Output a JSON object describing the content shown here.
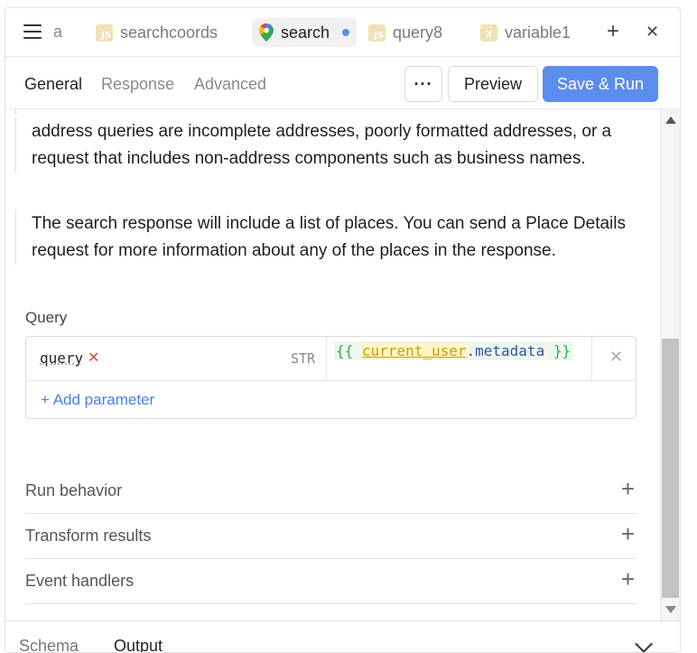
{
  "tabs": {
    "truncated_label": "a",
    "items": [
      {
        "label": "searchcoords",
        "icon": "js-icon",
        "badge": "JS"
      },
      {
        "label": "search",
        "icon": "google-maps-icon",
        "active": true,
        "unsaved": true
      },
      {
        "label": "query8",
        "icon": "js-icon",
        "badge": "JS"
      },
      {
        "label": "variable1",
        "icon": "variable-icon",
        "badge": "x"
      }
    ],
    "add_symbol": "+",
    "close_symbol": "✕"
  },
  "subnav": {
    "tabs": [
      "General",
      "Response",
      "Advanced"
    ],
    "active": "General",
    "more_label": "···",
    "preview_label": "Preview",
    "save_run_label": "Save & Run"
  },
  "description": {
    "paragraph1": "address queries are incomplete addresses, poorly formatted addresses, or a request that includes non-address components such as business names.",
    "paragraph2": "The search response will include a list of places. You can send a Place Details request for more information about any of the places in the response."
  },
  "query": {
    "section_label": "Query",
    "param_key": "query",
    "required_mark": "✕",
    "type": "STR",
    "value_open": "{{ ",
    "value_var": "current_user",
    "value_prop": ".metadata",
    "value_close": " }}",
    "remove_symbol": "✕",
    "add_parameter_label": "+ Add parameter"
  },
  "accordions": [
    {
      "label": "Run behavior"
    },
    {
      "label": "Transform results"
    },
    {
      "label": "Event handlers"
    }
  ],
  "accordion_symbol": "+",
  "bottom": {
    "tabs": [
      "Schema",
      "Output"
    ],
    "active": "Output"
  },
  "colors": {
    "primary": "#5b8def",
    "link": "#4a7de8",
    "required": "#d04a3a"
  }
}
